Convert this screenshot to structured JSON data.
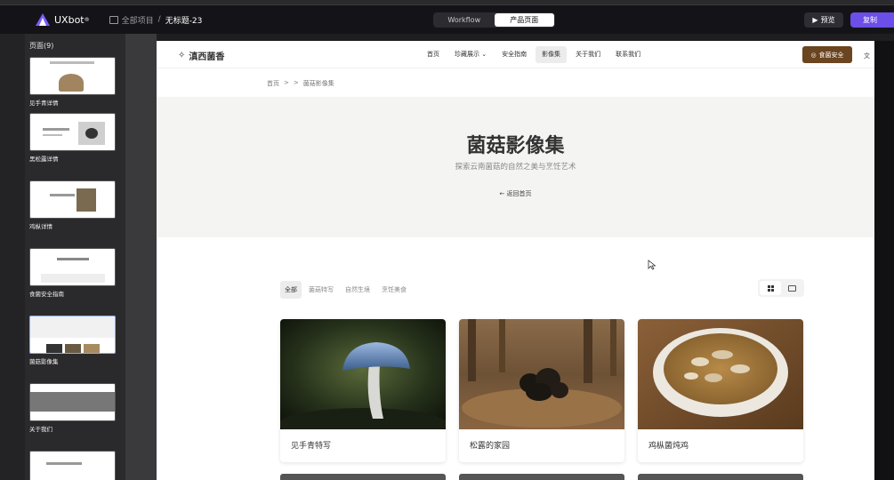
{
  "app": {
    "logo_text": "UXbot",
    "breadcrumb_root": "全部项目",
    "breadcrumb_sep": "/",
    "project_name": "无标题-23",
    "modes": [
      "Workflow",
      "产品页面"
    ],
    "active_mode": "产品页面",
    "preview_label": "预览",
    "copy_label": "复制"
  },
  "pages_panel": {
    "header": "页面(9)",
    "items": [
      {
        "label": "见手青详情"
      },
      {
        "label": "黑松露详情"
      },
      {
        "label": "鸡枞详情"
      },
      {
        "label": "食菌安全指南"
      },
      {
        "label": "菌菇影像集",
        "selected": true
      },
      {
        "label": "关于我们"
      },
      {
        "label": ""
      }
    ]
  },
  "site": {
    "brand": "滇西菌香",
    "nav": [
      "首页",
      "珍藏展示",
      "安全指南",
      "影像集",
      "关于我们",
      "联系我们"
    ],
    "nav_active": "影像集",
    "cta": "食菌安全",
    "breadcrumb": [
      "首页",
      ">",
      ">",
      "菌菇影像集"
    ],
    "hero_title": "菌菇影像集",
    "hero_subtitle": "探索云南菌菇的自然之美与烹饪艺术",
    "hero_back": "返回首页",
    "filters": [
      "全部",
      "菌菇特写",
      "自然生境",
      "烹饪美食"
    ],
    "filter_active": "全部",
    "cards": [
      {
        "title": "见手青特写",
        "icon": "mushroom-photo"
      },
      {
        "title": "松露的家园",
        "icon": "truffle-photo"
      },
      {
        "title": "鸡枞菌炖鸡",
        "icon": "soup-photo"
      }
    ]
  },
  "colors": {
    "accent": "#6c4ee8",
    "cta_brown": "#6b4420",
    "topbar": "#141418"
  }
}
